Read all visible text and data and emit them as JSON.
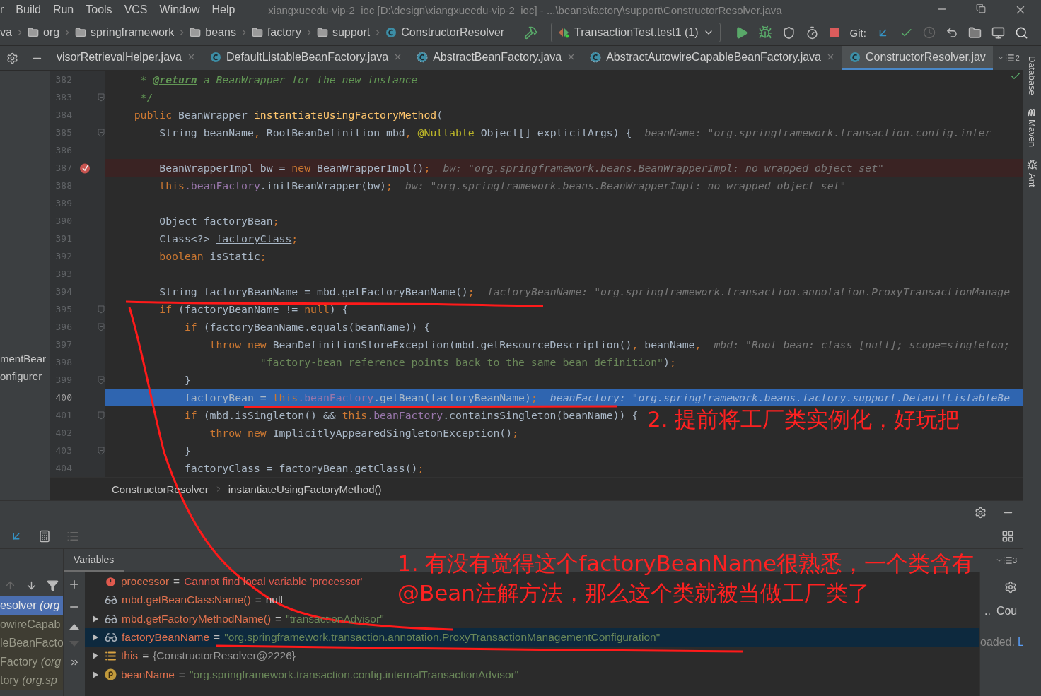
{
  "menu": [
    {
      "label": "r"
    },
    {
      "label": "Build"
    },
    {
      "label": "Run"
    },
    {
      "label": "Tools"
    },
    {
      "label": "VCS"
    },
    {
      "label": "Window"
    },
    {
      "label": "Help"
    }
  ],
  "window_title": "xiangxueedu-vip-2_ioc [D:\\design\\xiangxueedu-vip-2_ioc] - ...\\beans\\factory\\support\\ConstructorResolver.java",
  "nav": {
    "crumbs": [
      {
        "label": "va",
        "kind": "plain"
      },
      {
        "label": "org",
        "kind": "folder"
      },
      {
        "label": "springframework",
        "kind": "folder"
      },
      {
        "label": "beans",
        "kind": "folder"
      },
      {
        "label": "factory",
        "kind": "folder"
      },
      {
        "label": "support",
        "kind": "folder"
      },
      {
        "label": "ConstructorResolver",
        "kind": "class"
      }
    ],
    "run_config": "TransactionTest.test1 (1)",
    "git_label": "Git:"
  },
  "tabs": [
    {
      "label": "visorRetrievalHelper.java",
      "kind": "plain",
      "selected": false,
      "closable": true
    },
    {
      "label": "DefaultListableBeanFactory.java",
      "kind": "class",
      "selected": false,
      "closable": true
    },
    {
      "label": "AbstractBeanFactory.java",
      "kind": "abstract",
      "selected": false,
      "closable": true
    },
    {
      "label": "AbstractAutowireCapableBeanFactory.java",
      "kind": "abstract",
      "selected": false,
      "closable": true
    },
    {
      "label": "ConstructorResolver.jav",
      "kind": "class",
      "selected": true,
      "closable": false
    }
  ],
  "tab_overflow_count": "2",
  "project_tree": [
    "mentBear",
    "onfigurer"
  ],
  "editor": {
    "lines": [
      {
        "number": "382",
        "breakpoint": false,
        "current": false,
        "fold": false,
        "tokens": [
          {
            "kind": "cmt",
            "text": "     * "
          },
          {
            "kind": "doctag",
            "text": "@return"
          },
          {
            "kind": "cmt",
            "text": " a BeanWrapper for the new instance"
          }
        ]
      },
      {
        "number": "383",
        "breakpoint": false,
        "current": false,
        "fold": true,
        "tokens": [
          {
            "kind": "cmt",
            "text": "     */"
          }
        ]
      },
      {
        "number": "384",
        "breakpoint": false,
        "current": false,
        "fold": false,
        "tokens": [
          {
            "kind": "kw",
            "text": "    public"
          },
          {
            "kind": "plain",
            "text": " BeanWrapper "
          },
          {
            "kind": "decl",
            "text": "instantiateUsingFactoryMethod"
          },
          {
            "kind": "plain",
            "text": "("
          }
        ]
      },
      {
        "number": "385",
        "breakpoint": false,
        "current": false,
        "fold": true,
        "tokens": [
          {
            "kind": "plain",
            "text": "        String beanName"
          },
          {
            "kind": "kw",
            "text": ","
          },
          {
            "kind": "plain",
            "text": " RootBeanDefinition mbd"
          },
          {
            "kind": "kw",
            "text": ","
          },
          {
            "kind": "ann",
            "text": " @Nullable"
          },
          {
            "kind": "plain",
            "text": " Object[] explicitArgs) {"
          }
        ],
        "hint": "beanName: \"org.springframework.transaction.config.inter"
      },
      {
        "number": "386",
        "breakpoint": false,
        "current": false,
        "fold": false
      },
      {
        "number": "387",
        "breakpoint": true,
        "current": false,
        "fold": false,
        "tokens": [
          {
            "kind": "plain",
            "text": "        BeanWrapperImpl bw = "
          },
          {
            "kind": "kw",
            "text": "new"
          },
          {
            "kind": "plain",
            "text": " BeanWrapperImpl()"
          },
          {
            "kind": "kw",
            "text": ";"
          }
        ],
        "hint": "bw: \"org.springframework.beans.BeanWrapperImpl: no wrapped object set\""
      },
      {
        "number": "388",
        "breakpoint": false,
        "current": false,
        "fold": false,
        "tokens": [
          {
            "kind": "kw",
            "text": "        this"
          },
          {
            "kind": "field",
            "text": ".beanFactory"
          },
          {
            "kind": "plain",
            "text": ".initBeanWrapper(bw)"
          },
          {
            "kind": "kw",
            "text": ";"
          }
        ],
        "hint": "bw: \"org.springframework.beans.BeanWrapperImpl: no wrapped object set\""
      },
      {
        "number": "389",
        "breakpoint": false,
        "current": false,
        "fold": false
      },
      {
        "number": "390",
        "breakpoint": false,
        "current": false,
        "fold": false,
        "tokens": [
          {
            "kind": "plain",
            "text": "        Object factoryBean"
          },
          {
            "kind": "kw",
            "text": ";"
          }
        ]
      },
      {
        "number": "391",
        "breakpoint": false,
        "current": false,
        "fold": false,
        "tokens": [
          {
            "kind": "plain",
            "text": "        Class<?> "
          },
          {
            "kind": "link",
            "text": "factoryClass"
          },
          {
            "kind": "kw",
            "text": ";"
          }
        ]
      },
      {
        "number": "392",
        "breakpoint": false,
        "current": false,
        "fold": false,
        "tokens": [
          {
            "kind": "kw",
            "text": "        boolean"
          },
          {
            "kind": "plain",
            "text": " isStatic"
          },
          {
            "kind": "kw",
            "text": ";"
          }
        ]
      },
      {
        "number": "393",
        "breakpoint": false,
        "current": false,
        "fold": false
      },
      {
        "number": "394",
        "breakpoint": false,
        "current": false,
        "fold": false,
        "tokens": [
          {
            "kind": "plain",
            "text": "        String factoryBeanName = mbd.getFactoryBeanName()"
          },
          {
            "kind": "kw",
            "text": ";"
          }
        ],
        "hint": "factoryBeanName: \"org.springframework.transaction.annotation.ProxyTransactionManage"
      },
      {
        "number": "395",
        "breakpoint": false,
        "current": false,
        "fold": true,
        "tokens": [
          {
            "kind": "kw",
            "text": "        if"
          },
          {
            "kind": "plain",
            "text": " (factoryBeanName != "
          },
          {
            "kind": "kw",
            "text": "null"
          },
          {
            "kind": "plain",
            "text": ") {"
          }
        ]
      },
      {
        "number": "396",
        "breakpoint": false,
        "current": false,
        "fold": true,
        "tokens": [
          {
            "kind": "kw",
            "text": "            if"
          },
          {
            "kind": "plain",
            "text": " (factoryBeanName.equals(beanName)) {"
          }
        ]
      },
      {
        "number": "397",
        "breakpoint": false,
        "current": false,
        "fold": false,
        "tokens": [
          {
            "kind": "kw",
            "text": "                throw new"
          },
          {
            "kind": "plain",
            "text": " BeanDefinitionStoreException(mbd.getResourceDescription()"
          },
          {
            "kind": "kw",
            "text": ","
          },
          {
            "kind": "plain",
            "text": " beanName"
          },
          {
            "kind": "kw",
            "text": ","
          }
        ],
        "hint": "mbd: \"Root bean: class [null]; scope=singleton;"
      },
      {
        "number": "398",
        "breakpoint": false,
        "current": false,
        "fold": false,
        "tokens": [
          {
            "kind": "str",
            "text": "                        \"factory-bean reference points back to the same bean definition\""
          },
          {
            "kind": "plain",
            "text": ")"
          },
          {
            "kind": "kw",
            "text": ";"
          }
        ]
      },
      {
        "number": "399",
        "breakpoint": false,
        "current": false,
        "fold": true,
        "tokens": [
          {
            "kind": "plain",
            "text": "            }"
          }
        ]
      },
      {
        "number": "400",
        "breakpoint": false,
        "current": true,
        "fold": false,
        "tokens": [
          {
            "kind": "plain",
            "text": "            factoryBean = "
          },
          {
            "kind": "kw",
            "text": "this"
          },
          {
            "kind": "field",
            "text": ".beanFactory"
          },
          {
            "kind": "plain",
            "text": ".getBean(factoryBeanName)"
          },
          {
            "kind": "kw",
            "text": ";"
          }
        ],
        "hint": "beanFactory: \"org.springframework.beans.factory.support.DefaultListableBe"
      },
      {
        "number": "401",
        "breakpoint": false,
        "current": false,
        "fold": true,
        "tokens": [
          {
            "kind": "kw",
            "text": "            if"
          },
          {
            "kind": "plain",
            "text": " (mbd.isSingleton() && "
          },
          {
            "kind": "kw",
            "text": "this"
          },
          {
            "kind": "field",
            "text": ".beanFactory"
          },
          {
            "kind": "plain",
            "text": ".containsSingleton(beanName)) {"
          }
        ]
      },
      {
        "number": "402",
        "breakpoint": false,
        "current": false,
        "fold": false,
        "tokens": [
          {
            "kind": "kw",
            "text": "                throw new"
          },
          {
            "kind": "plain",
            "text": " ImplicitlyAppearedSingletonException()"
          },
          {
            "kind": "kw",
            "text": ";"
          }
        ]
      },
      {
        "number": "403",
        "breakpoint": false,
        "current": false,
        "fold": true,
        "tokens": [
          {
            "kind": "plain",
            "text": "            }"
          }
        ]
      },
      {
        "number": "404",
        "breakpoint": false,
        "current": false,
        "fold": false,
        "tokens": [
          {
            "kind": "link",
            "text": "            factoryClass"
          },
          {
            "kind": "plain",
            "text": " = factoryBean.getClass()"
          },
          {
            "kind": "kw",
            "text": ";"
          }
        ]
      }
    ]
  },
  "breadcrumbs": [
    "ConstructorResolver",
    "instantiateUsingFactoryMethod()"
  ],
  "debug": {
    "frames": [
      {
        "label": "esolver *(org*",
        "selected": true
      },
      {
        "label": "owireCapab",
        "selected": false
      },
      {
        "label": "leBeanFacto",
        "selected": false
      },
      {
        "label": "Factory *(org*",
        "selected": false
      },
      {
        "label": "tory *(org.sp*",
        "selected": false
      }
    ],
    "variables_tab": "Variables",
    "layout_count": "3",
    "variables": [
      {
        "kind": "error",
        "name": "processor",
        "sign": "=",
        "value": {
          "kind": "error",
          "text": "Cannot find local variable 'processor'"
        },
        "expandable": false,
        "selected": false
      },
      {
        "kind": "watch",
        "name": "mbd.getBeanClassName()",
        "sign": "=",
        "value": {
          "kind": "plain",
          "text": "null"
        },
        "expandable": false,
        "selected": false
      },
      {
        "kind": "watch",
        "name": "mbd.getFactoryMethodName()",
        "sign": "=",
        "value": {
          "kind": "string",
          "text": "\"transactionAdvisor\""
        },
        "expandable": true,
        "selected": false
      },
      {
        "kind": "watch",
        "name": "factoryBeanName",
        "sign": "=",
        "value": {
          "kind": "string",
          "text": "\"org.springframework.transaction.annotation.ProxyTransactionManagementConfiguration\""
        },
        "expandable": true,
        "selected": true
      },
      {
        "kind": "field",
        "name": "this",
        "sign": "=",
        "value": {
          "kind": "object",
          "text": "{ConstructorResolver@2226}"
        },
        "expandable": true,
        "selected": false
      },
      {
        "kind": "param",
        "name": "beanName",
        "sign": "=",
        "value": {
          "kind": "string",
          "text": "\"org.springframework.transaction.config.internalTransactionAdvisor\""
        },
        "expandable": true,
        "selected": false
      }
    ],
    "side": {
      "tab_more": "..",
      "tab": "Cou",
      "status": "oaded.",
      "link": "L"
    }
  },
  "tool_windows": [
    {
      "label": "Database",
      "kind": "plain"
    },
    {
      "label": "Maven",
      "kind": "maven"
    },
    {
      "label": "Ant",
      "kind": "ant"
    }
  ],
  "annotations": [
    {
      "lines": [
        "2. 提前将工厂类实例化，好玩把"
      ]
    },
    {
      "lines": [
        "1. 有没有觉得这个factoryBeanName很熟悉，一个类含有",
        "@Bean注解方法，那么这个类就被当做工厂类了"
      ]
    }
  ]
}
